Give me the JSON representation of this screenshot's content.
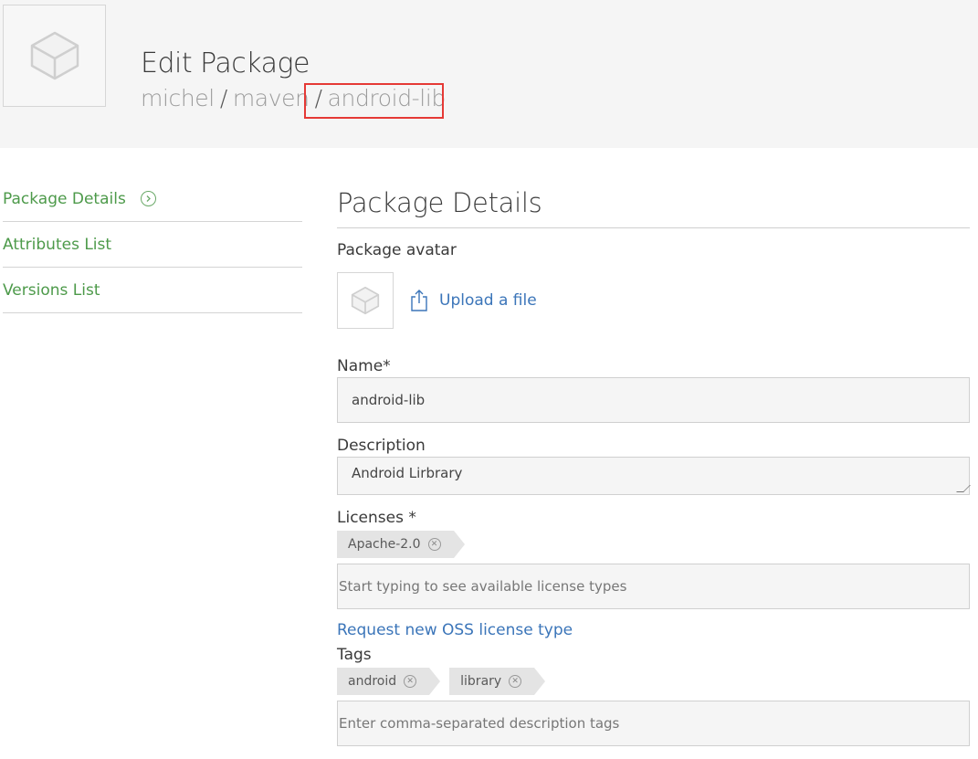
{
  "header": {
    "title": "Edit Package",
    "breadcrumb": {
      "owner": "michel",
      "repo": "maven",
      "package": "android-lib",
      "separator": "/"
    },
    "logo_icon": "package-box-icon"
  },
  "sidenav": {
    "items": [
      {
        "label": "Package Details",
        "active": true
      },
      {
        "label": "Attributes List"
      },
      {
        "label": "Versions List"
      }
    ]
  },
  "main": {
    "section_title": "Package Details",
    "avatar": {
      "label": "Package avatar",
      "upload_label": "Upload a file"
    },
    "name": {
      "label": "Name*",
      "value": "android-lib"
    },
    "description": {
      "label": "Description",
      "value": "Android Lirbrary"
    },
    "licenses": {
      "label": "Licenses *",
      "selected": [
        "Apache-2.0"
      ],
      "placeholder": "Start typing to see available license types",
      "request_link": "Request new OSS license type"
    },
    "tags": {
      "label": "Tags",
      "selected": [
        "android",
        "library"
      ],
      "placeholder": "Enter comma-separated description tags"
    }
  },
  "colors": {
    "nav_green": "#4d9a4a",
    "link_blue": "#3b75b9",
    "highlight_red": "#e53935"
  }
}
